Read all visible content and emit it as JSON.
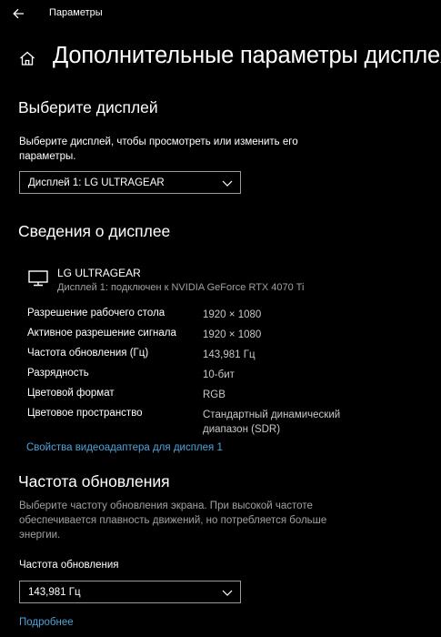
{
  "header": {
    "back_icon": "arrow-left-icon",
    "app_title": "Параметры"
  },
  "page": {
    "home_icon": "home-icon",
    "title": "Дополнительные параметры дисплея"
  },
  "select_display": {
    "heading": "Выберите дисплей",
    "description": "Выберите дисплей, чтобы просмотреть или изменить его параметры.",
    "selected_value": "Дисплей 1: LG ULTRAGEAR"
  },
  "display_info": {
    "heading": "Сведения о дисплее",
    "monitor_icon": "monitor-icon",
    "monitor_name": "LG ULTRAGEAR",
    "monitor_sub": "Дисплей 1: подключен к NVIDIA GeForce RTX 4070 Ti",
    "rows": [
      {
        "label": "Разрешение рабочего стола",
        "value": "1920 × 1080"
      },
      {
        "label": "Активное разрешение сигнала",
        "value": "1920 × 1080"
      },
      {
        "label": "Частота обновления (Гц)",
        "value": "143,981 Гц"
      },
      {
        "label": "Разрядность",
        "value": "10-бит"
      },
      {
        "label": "Цветовой формат",
        "value": "RGB"
      },
      {
        "label": "Цветовое пространство",
        "value": "Стандартный динамический диапазон (SDR)"
      }
    ],
    "adapter_link": "Свойства видеоадаптера для дисплея 1"
  },
  "refresh_rate": {
    "heading": "Частота обновления",
    "description": "Выберите частоту обновления экрана. При высокой частоте обеспечивается плавность движений, но потребляется больше энергии.",
    "field_label": "Частота обновления",
    "selected_value": "143,981 Гц",
    "more_link": "Подробнее"
  },
  "colors": {
    "background": "#000000",
    "text": "#ffffff",
    "muted_text": "#a0a0a0",
    "link": "#4ea3d8",
    "border": "#9a9a9a"
  }
}
